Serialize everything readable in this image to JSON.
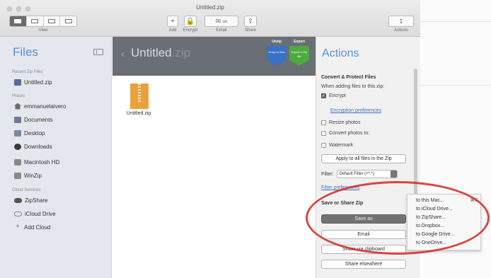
{
  "window": {
    "title": "Untitled.zip",
    "toolbar": {
      "view_label": "View",
      "add_label": "Add",
      "encrypt_label": "Encrypt",
      "email_label": "Email",
      "share_label": "Share",
      "actions_label": "Actions"
    }
  },
  "sidebar": {
    "title": "Files",
    "recent_header": "Recent Zip Files",
    "recent_items": [
      "Untitled.zip"
    ],
    "places_header": "Places",
    "places": [
      "emmanuelaivero",
      "Documents",
      "Desktop",
      "Downloads",
      "Macintosh HD",
      "WinZip"
    ],
    "cloud_header": "Cloud Services",
    "cloud": [
      "ZipShare",
      "iCloud Drive",
      "Add Cloud"
    ]
  },
  "main": {
    "back_glyph": "‹",
    "archive_name": "Untitled",
    "archive_ext": ".zip",
    "unzip_label": "Unzip",
    "unzip_sub": "Unzip to Mac",
    "export_label": "Export",
    "export_sub": "Export to Zip file",
    "file_name": "Untitled.zip"
  },
  "actions": {
    "title": "Actions",
    "convert_header": "Convert & Protect Files",
    "when_adding": "When adding files to this zip:",
    "encrypt": "Encrypt",
    "encrypt_checked": true,
    "encryption_prefs": "Encryption preferences",
    "resize_photos": "Resize photos",
    "convert_photos": "Convert photos to:",
    "watermark": "Watermark",
    "apply_all": "Apply to all files in the Zip",
    "filter_label": "Filter:",
    "filter_value": "Default Filter (+*.*)",
    "filter_prefs": "Filter preferences",
    "save_share_header": "Save or Share Zip",
    "save_as": "Save as",
    "email": "Email",
    "share_clipboard": "Share via clipboard",
    "share_elsewhere": "Share elsewhere"
  },
  "menu": {
    "items": [
      {
        "label": "to this Mac...",
        "shortcut": "⌘S"
      },
      {
        "label": "to iCloud Drive...",
        "shortcut": ""
      },
      {
        "label": "to ZipShare...",
        "shortcut": ""
      },
      {
        "label": "to Dropbox...",
        "shortcut": ""
      },
      {
        "label": "to Google Drive...",
        "shortcut": ""
      },
      {
        "label": "to OneDrive...",
        "shortcut": ""
      }
    ]
  },
  "colors": {
    "accent": "#5a8fd6",
    "annotation": "#d6322b",
    "unzip": "#3872c8",
    "export": "#4caa3f"
  }
}
